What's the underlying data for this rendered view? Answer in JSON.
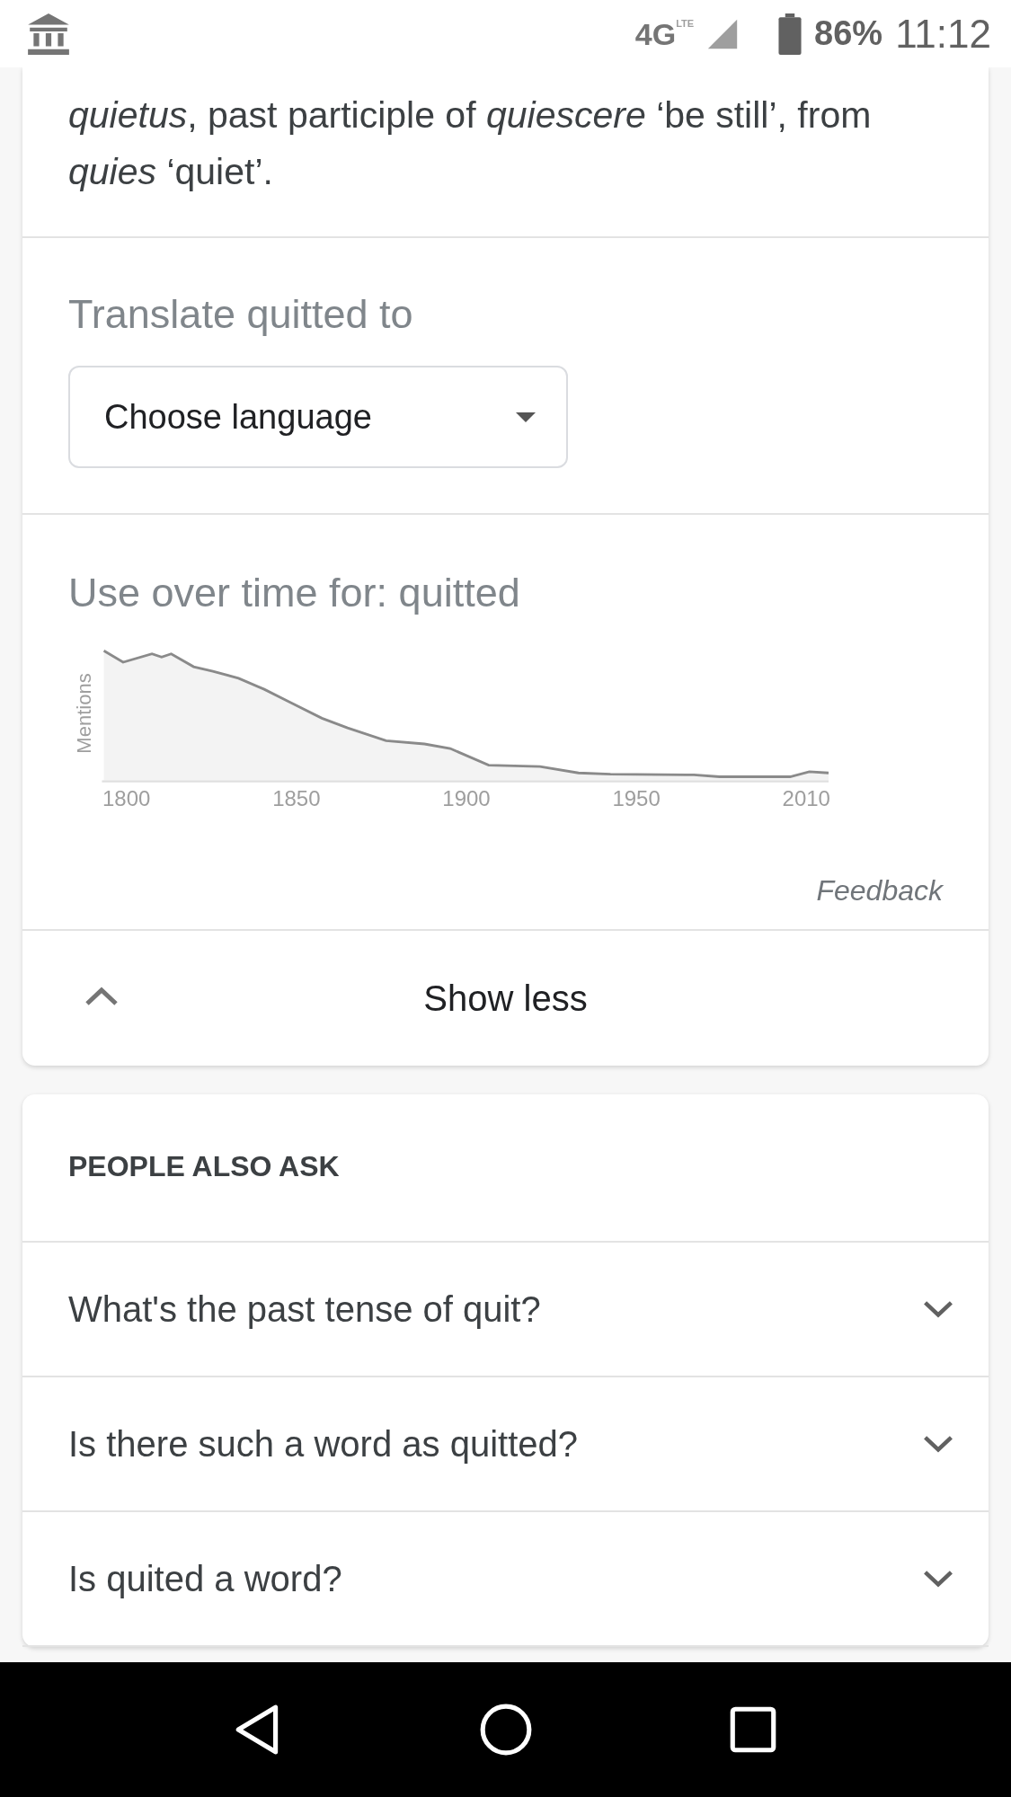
{
  "status_bar": {
    "network": "4G",
    "network_sub": "LTE",
    "battery": "86%",
    "time": "11:12"
  },
  "origin": {
    "lines": [
      "*quietus*, past participle of *quiescere* ‘be still’, from",
      "*quies* ‘quiet’."
    ]
  },
  "translate": {
    "title": "Translate quitted to",
    "dropdown": {
      "value": "Choose language"
    }
  },
  "usage": {
    "title": "Use over time for: quitted",
    "ylabel": "Mentions",
    "x_labels": [
      "1800",
      "1850",
      "1900",
      "1950",
      "2010"
    ],
    "feedback": "Feedback"
  },
  "toggle": {
    "label": "Show less",
    "expanded": true
  },
  "people_also_ask": {
    "title": "PEOPLE ALSO ASK",
    "questions": [
      {
        "text": "What's the past tense of quit?",
        "expanded": false
      },
      {
        "text": "Is there such a word as quitted?",
        "expanded": false
      },
      {
        "text": "Is quited a word?",
        "expanded": false
      }
    ]
  }
}
